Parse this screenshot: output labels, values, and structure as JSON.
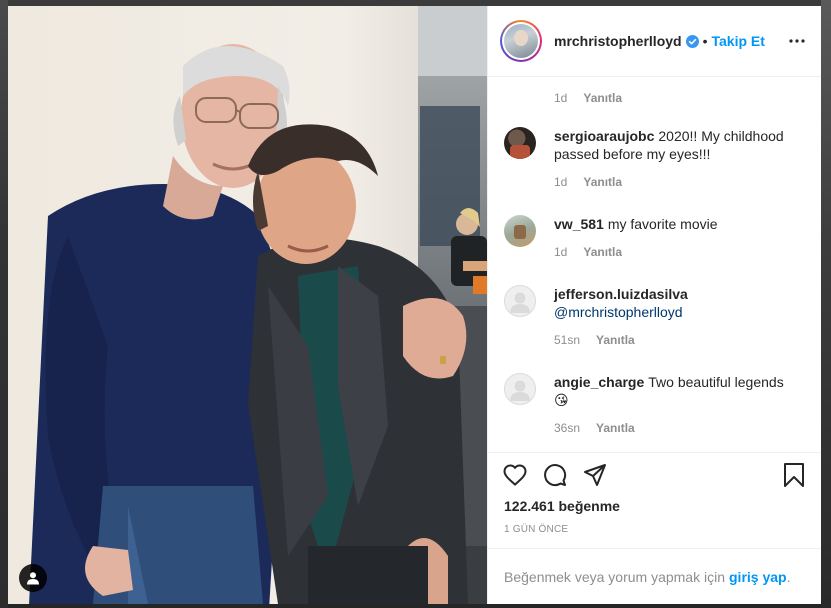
{
  "post": {
    "username": "mrchristopherlloyd",
    "separator": "•",
    "follow_label": "Takip Et",
    "likes_text": "122.461 beğenme",
    "time_ago": "1 GÜN ÖNCE"
  },
  "comments": [
    {
      "username": "",
      "text": "",
      "time": "1d",
      "reply_label": "Yanıtla",
      "avatar": "none"
    },
    {
      "username": "sergioaraujobc",
      "text": "2020!! My childhood passed before my eyes!!!",
      "time": "1d",
      "reply_label": "Yanıtla",
      "avatar": "photo-dark"
    },
    {
      "username": "vw_581",
      "text": "my favorite movie",
      "time": "1d",
      "reply_label": "Yanıtla",
      "avatar": "photo-light"
    },
    {
      "username": "jefferson.luizdasilva",
      "mention": "@mrchristopherlloyd",
      "time": "51sn",
      "reply_label": "Yanıtla",
      "avatar": "default"
    },
    {
      "username": "angie_charge",
      "text": "Two beautiful legends",
      "emoji": "😘",
      "time": "36sn",
      "reply_label": "Yanıtla",
      "avatar": "default"
    }
  ],
  "login": {
    "prompt": "Beğenmek veya yorum yapmak için",
    "link": "giriş yap",
    "suffix": "."
  },
  "colors": {
    "accent": "#0095f6",
    "text": "#262626",
    "muted": "#8e8e8e",
    "border": "#efefef"
  }
}
